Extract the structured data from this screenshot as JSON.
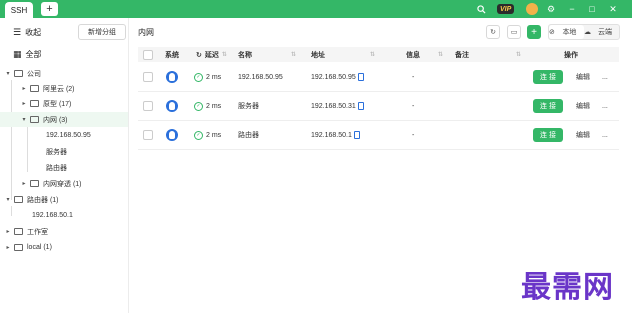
{
  "tabs": {
    "active_label": "SSH",
    "add_label": "+"
  },
  "topbar": {
    "vip_label": "VIP",
    "search_icon": "search-icon",
    "settings_icon": "gear-icon"
  },
  "window": {
    "minimize": "−",
    "maximize": "□",
    "close": "✕"
  },
  "sidebar": {
    "collapse_label": "收起",
    "all_label": "全部",
    "new_group_label": "新增分组",
    "tree": [
      {
        "label": "公司",
        "caret": "▾"
      },
      {
        "label": "阿里云 (2)",
        "caret": "▸"
      },
      {
        "label": "原型 (17)",
        "caret": "▸"
      },
      {
        "label": "内网 (3)",
        "caret": "▾"
      },
      {
        "label": "192.168.50.95"
      },
      {
        "label": "服务器"
      },
      {
        "label": "路由器"
      },
      {
        "label": "内网穿透 (1)",
        "caret": "▸"
      },
      {
        "label": "路由器 (1)",
        "caret": "▾"
      },
      {
        "label": "192.168.50.1"
      },
      {
        "label": "工作室",
        "caret": "▸"
      },
      {
        "label": "local (1)",
        "caret": "▸"
      }
    ]
  },
  "main": {
    "breadcrumb": "内网",
    "view_toggle": {
      "local": "本地",
      "cloud": "云端"
    },
    "columns": {
      "system": "系统",
      "latency": "延迟",
      "name": "名称",
      "address": "地址",
      "info": "信息",
      "note": "备注",
      "actions": "操作"
    },
    "rows": [
      {
        "latency": "2 ms",
        "name": "192.168.50.95",
        "address": "192.168.50.95",
        "info": "-",
        "connect": "连 接",
        "edit": "编辑",
        "more": "..."
      },
      {
        "latency": "2 ms",
        "name": "服务器",
        "address": "192.168.50.31",
        "info": "-",
        "connect": "连 接",
        "edit": "编辑",
        "more": "..."
      },
      {
        "latency": "2 ms",
        "name": "路由器",
        "address": "192.168.50.1",
        "info": "-",
        "connect": "连 接",
        "edit": "编辑",
        "more": "..."
      }
    ]
  },
  "watermark": "最需网",
  "colors": {
    "accent": "#34b767",
    "watermark": "#6a35c8"
  }
}
